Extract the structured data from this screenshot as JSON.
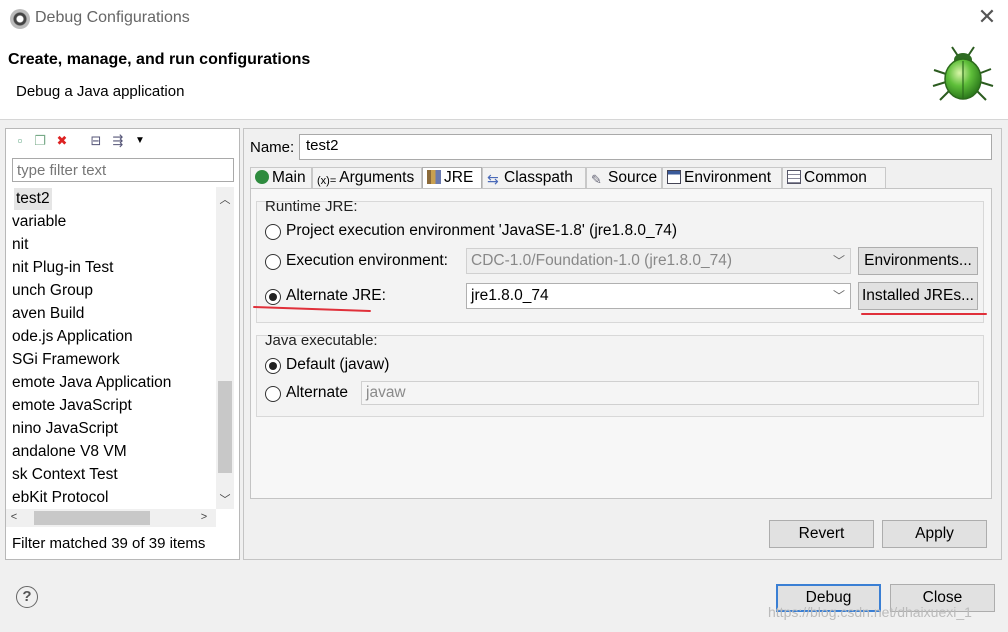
{
  "window": {
    "title": "Debug Configurations"
  },
  "header": {
    "title": "Create, manage, and run configurations",
    "subtitle": "Debug a Java application"
  },
  "left": {
    "filter_placeholder": "type filter text",
    "items": [
      "test2",
      "variable",
      "nit",
      "nit Plug-in Test",
      "unch Group",
      "aven Build",
      "ode.js Application",
      "SGi Framework",
      "emote Java Application",
      "emote JavaScript",
      "nino JavaScript",
      "andalone V8 VM",
      "sk Context Test",
      "ebKit Protocol"
    ],
    "status": "Filter matched 39 of 39 items"
  },
  "config": {
    "name_label": "Name:",
    "name_value": "test2",
    "tabs": [
      "Main",
      "Arguments",
      "JRE",
      "Classpath",
      "Source",
      "Environment",
      "Common"
    ],
    "active_tab": "JRE"
  },
  "jre": {
    "runtime_label": "Runtime JRE:",
    "opt_project": "Project execution environment 'JavaSE-1.8' (jre1.8.0_74)",
    "opt_exec_env": "Execution environment:",
    "exec_env_value": "CDC-1.0/Foundation-1.0 (jre1.8.0_74)",
    "environments_button": "Environments...",
    "opt_alternate": "Alternate JRE:",
    "alternate_value": "jre1.8.0_74",
    "installed_button": "Installed JREs...",
    "selected": "alternate"
  },
  "executable": {
    "label": "Java executable:",
    "opt_default": "Default (javaw)",
    "opt_alternate": "Alternate",
    "alternate_value": "javaw",
    "selected": "default"
  },
  "buttons": {
    "revert": "Revert",
    "apply": "Apply",
    "debug": "Debug",
    "close": "Close"
  },
  "watermark": "https://blog.csdn.net/dhaixuexi_1",
  "colors": {
    "accent": "#3a7fd4",
    "annotation": "#e0303a"
  }
}
